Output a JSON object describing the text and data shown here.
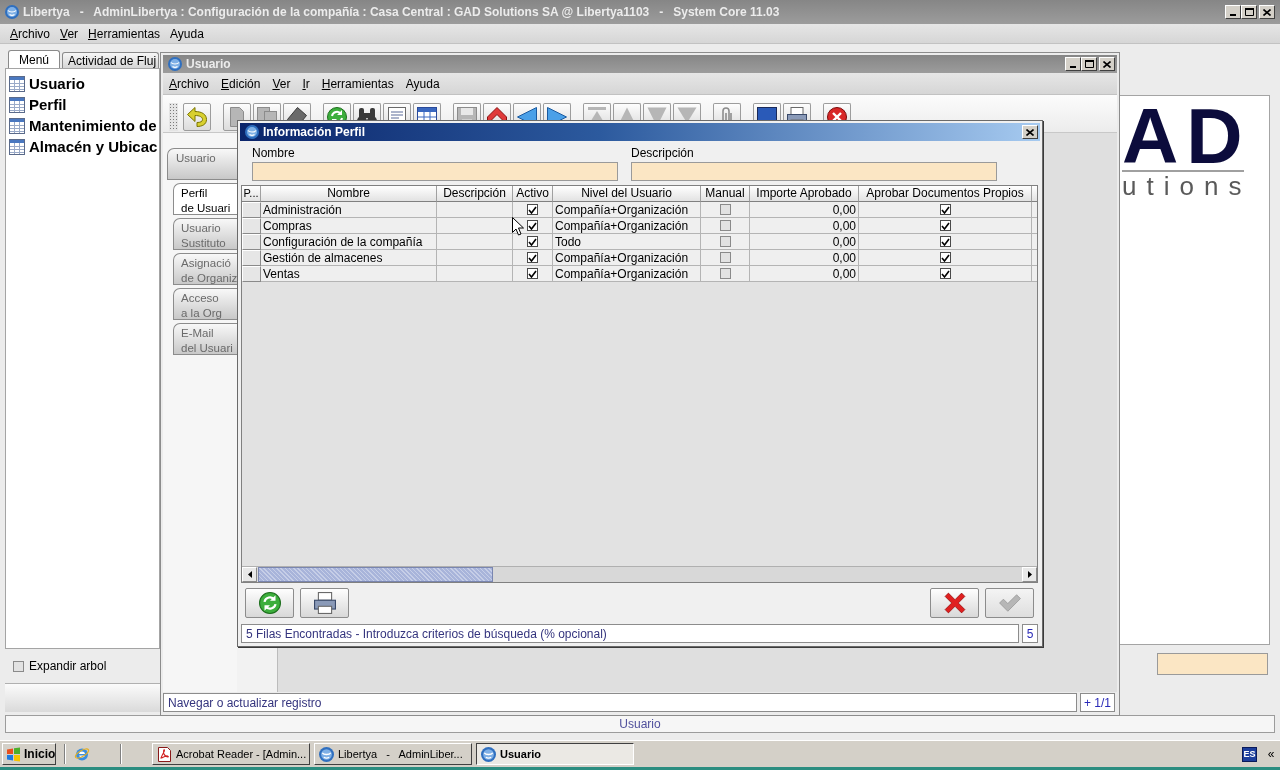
{
  "main_window": {
    "title": "Libertya   -   AdminLibertya : Configuración de la compañía : Casa Central : GAD Solutions SA @ Libertya1103   -   System Core 11.03",
    "active": false,
    "menu": [
      {
        "label": "Archivo",
        "mnemonic": true
      },
      {
        "label": "Ver",
        "mnemonic": true
      },
      {
        "label": "Herramientas",
        "mnemonic": true
      },
      {
        "label": "Ayuda",
        "mnemonic": false
      }
    ],
    "tabs": [
      {
        "label": "Menú",
        "selected": true
      },
      {
        "label": "Actividad de Fluj",
        "selected": false
      }
    ],
    "tree_items": [
      "Usuario",
      "Perfil",
      "Mantenimiento de",
      "Almacén y Ubicac"
    ],
    "expand_tree": {
      "label": "Expandir arbol",
      "checked": false
    },
    "logo": {
      "mark": "AD",
      "tagline": "utions"
    },
    "status_bar": "Usuario"
  },
  "usuario_window": {
    "title": "Usuario",
    "active": false,
    "menu": [
      {
        "label": "Archivo",
        "mnemonic": true
      },
      {
        "label": "Edición",
        "mnemonic": true
      },
      {
        "label": "Ver",
        "mnemonic": true
      },
      {
        "label": "Ir",
        "mnemonic": true
      },
      {
        "label": "Herramientas",
        "mnemonic": true
      },
      {
        "label": "Ayuda",
        "mnemonic": false
      }
    ],
    "toolbar_groups": [
      {
        "buttons": [
          {
            "kind": "undo",
            "disabled": false
          }
        ]
      },
      {
        "buttons": [
          {
            "kind": "new",
            "disabled": true
          },
          {
            "kind": "copy",
            "disabled": true
          },
          {
            "kind": "delete",
            "disabled": false
          }
        ]
      },
      {
        "buttons": [
          {
            "kind": "refresh",
            "disabled": false
          },
          {
            "kind": "find",
            "disabled": false
          },
          {
            "kind": "history",
            "disabled": false
          },
          {
            "kind": "grid",
            "disabled": false
          }
        ]
      },
      {
        "buttons": [
          {
            "kind": "save",
            "disabled": true
          },
          {
            "kind": "parent",
            "disabled": false
          },
          {
            "kind": "back",
            "disabled": false
          },
          {
            "kind": "detail",
            "disabled": false
          }
        ]
      },
      {
        "buttons": [
          {
            "kind": "first",
            "disabled": true
          },
          {
            "kind": "previous",
            "disabled": true
          },
          {
            "kind": "next",
            "disabled": true
          },
          {
            "kind": "last",
            "disabled": true
          }
        ]
      },
      {
        "buttons": [
          {
            "kind": "attachment",
            "disabled": true
          }
        ]
      },
      {
        "buttons": [
          {
            "kind": "report",
            "disabled": false
          },
          {
            "kind": "print",
            "disabled": false
          }
        ]
      },
      {
        "buttons": [
          {
            "kind": "exit",
            "disabled": false
          }
        ]
      }
    ],
    "tabs": [
      {
        "lines": [
          "Usuario"
        ],
        "selected": false,
        "children": [
          {
            "lines": [
              "Perfil",
              "de Usuari"
            ],
            "selected": true
          },
          {
            "lines": [
              "Usuario",
              "Sustituto"
            ],
            "selected": false
          },
          {
            "lines": [
              "Asignació",
              "de Organiz"
            ],
            "selected": false
          },
          {
            "lines": [
              "Acceso",
              "a la Org"
            ],
            "selected": false
          },
          {
            "lines": [
              "E-Mail",
              "del Usuari"
            ],
            "selected": false
          }
        ]
      }
    ],
    "status": {
      "message": "Navegar o actualizar registro",
      "record": "+ 1/1"
    }
  },
  "dialog": {
    "title": "Información Perfil",
    "active": true,
    "fields": [
      {
        "label": "Nombre"
      },
      {
        "label": "Descripción"
      }
    ],
    "table": {
      "columns": [
        "P...",
        "Nombre",
        "Descripción",
        "Activo",
        "Nivel del Usuario",
        "Manual",
        "Importe Aprobado",
        "Aprobar Documentos Propios"
      ],
      "rows": [
        {
          "name": "Administración",
          "active": true,
          "user_level": "Compañía+Organización",
          "manual": false,
          "approved_amount": "0,00",
          "approve_own_documents": true
        },
        {
          "name": "Compras",
          "active": true,
          "user_level": "Compañía+Organización",
          "manual": false,
          "approved_amount": "0,00",
          "approve_own_documents": true
        },
        {
          "name": "Configuración de la compañía",
          "active": true,
          "user_level": "Todo",
          "manual": false,
          "approved_amount": "0,00",
          "approve_own_documents": true
        },
        {
          "name": "Gestión de almacenes",
          "active": true,
          "user_level": "Compañía+Organización",
          "manual": false,
          "approved_amount": "0,00",
          "approve_own_documents": true
        },
        {
          "name": "Ventas",
          "active": true,
          "user_level": "Compañía+Organización",
          "manual": false,
          "approved_amount": "0,00",
          "approve_own_documents": true
        }
      ]
    },
    "buttons": [
      {
        "kind": "refresh",
        "disabled": false
      },
      {
        "kind": "print",
        "disabled": false
      },
      {
        "kind": "cancel",
        "disabled": false
      },
      {
        "kind": "ok",
        "disabled": true
      }
    ],
    "status": {
      "message": "5 Filas Encontradas - Introduzca criterios de búsqueda (% opcional)",
      "count": "5"
    }
  },
  "taskbar": {
    "start_label": "Inicio",
    "tasks": [
      {
        "label": "Acrobat Reader - [Admin...",
        "kind": "pdf",
        "selected": false
      },
      {
        "label": "Libertya   -   AdminLiber...",
        "kind": "app",
        "selected": false
      },
      {
        "label": "Usuario",
        "kind": "app",
        "selected": true
      }
    ],
    "language": "ES",
    "tray_toggle": "«"
  }
}
